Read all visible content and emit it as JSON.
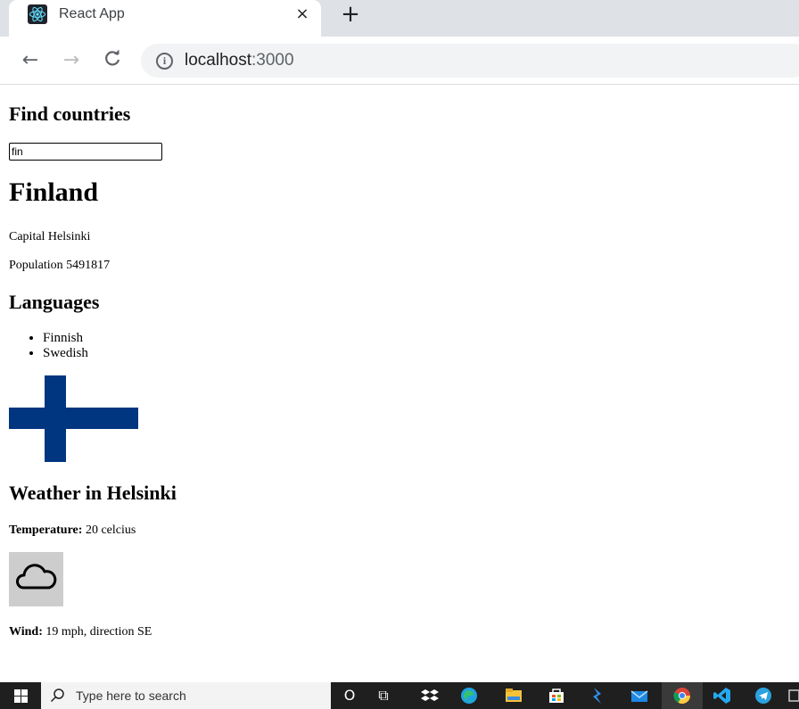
{
  "browser": {
    "tab_title": "React App",
    "tab_close": "×",
    "new_tab": "+",
    "back": "←",
    "forward": "→",
    "reload": "C",
    "info": "i",
    "url_host": "localhost",
    "url_port": ":3000"
  },
  "page": {
    "find_title": "Find countries",
    "search_value": "fin",
    "country_name": "Finland",
    "capital": "Capital Helsinki",
    "population": "Population 5491817",
    "languages_title": "Languages",
    "languages": [
      "Finnish",
      "Swedish"
    ],
    "flag_colors": {
      "field": "#ffffff",
      "cross": "#003580"
    },
    "weather_title": "Weather in Helsinki",
    "temperature_label": "Temperature:",
    "temperature_value": " 20 celcius",
    "weather_icon": "cloud-icon",
    "wind_label": "Wind:",
    "wind_value": " 19 mph, direction SE"
  },
  "taskbar": {
    "search_placeholder": "Type here to search",
    "cortana": "O",
    "task_view": "⧉"
  }
}
